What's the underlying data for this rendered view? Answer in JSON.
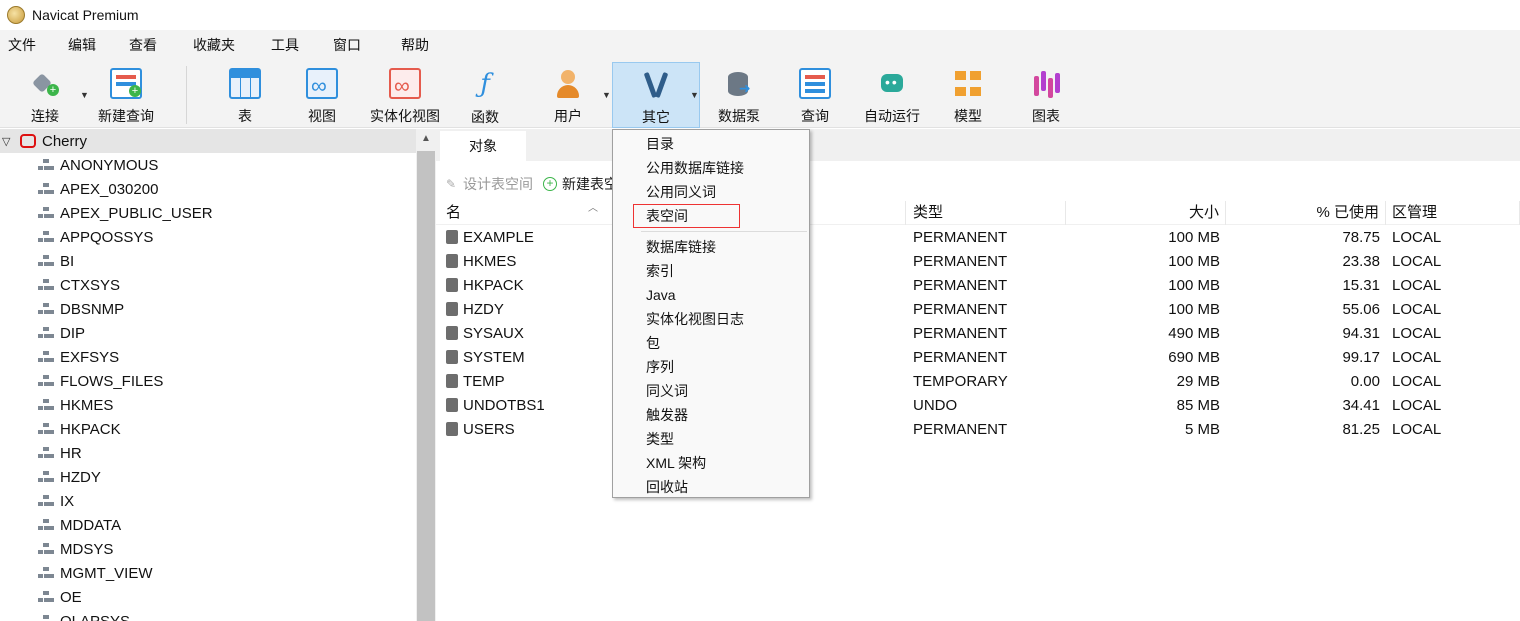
{
  "window": {
    "title": "Navicat Premium"
  },
  "menubar": [
    "文件",
    "编辑",
    "查看",
    "收藏夹",
    "工具",
    "窗口",
    "帮助"
  ],
  "toolbar": {
    "connect": "连接",
    "new_query": "新建查询",
    "table": "表",
    "view": "视图",
    "materialized_view": "实体化视图",
    "function": "函数",
    "user": "用户",
    "other": "其它",
    "data_pump": "数据泵",
    "query": "查询",
    "automation": "自动运行",
    "model": "模型",
    "chart": "图表"
  },
  "tree": {
    "connection": "Cherry",
    "schemas": [
      "ANONYMOUS",
      "APEX_030200",
      "APEX_PUBLIC_USER",
      "APPQOSSYS",
      "BI",
      "CTXSYS",
      "DBSNMP",
      "DIP",
      "EXFSYS",
      "FLOWS_FILES",
      "HKMES",
      "HKPACK",
      "HR",
      "HZDY",
      "IX",
      "MDDATA",
      "MDSYS",
      "MGMT_VIEW",
      "OE",
      "OLAPSYS"
    ]
  },
  "tabs": {
    "objects": "对象"
  },
  "object_toolbar": {
    "design": "设计表空间",
    "new": "新建表空间"
  },
  "grid": {
    "headers": {
      "name": "名",
      "type": "类型",
      "size": "大小",
      "pct_used": "% 已使用",
      "extent": "区管理"
    },
    "rows": [
      {
        "name": "EXAMPLE",
        "type": "PERMANENT",
        "size": "100 MB",
        "pct": "78.75",
        "extent": "LOCAL"
      },
      {
        "name": "HKMES",
        "type": "PERMANENT",
        "size": "100 MB",
        "pct": "23.38",
        "extent": "LOCAL"
      },
      {
        "name": "HKPACK",
        "type": "PERMANENT",
        "size": "100 MB",
        "pct": "15.31",
        "extent": "LOCAL"
      },
      {
        "name": "HZDY",
        "type": "PERMANENT",
        "size": "100 MB",
        "pct": "55.06",
        "extent": "LOCAL"
      },
      {
        "name": "SYSAUX",
        "type": "PERMANENT",
        "size": "490 MB",
        "pct": "94.31",
        "extent": "LOCAL"
      },
      {
        "name": "SYSTEM",
        "type": "PERMANENT",
        "size": "690 MB",
        "pct": "99.17",
        "extent": "LOCAL"
      },
      {
        "name": "TEMP",
        "type": "TEMPORARY",
        "size": "29 MB",
        "pct": "0.00",
        "extent": "LOCAL"
      },
      {
        "name": "UNDOTBS1",
        "type": "UNDO",
        "size": "85 MB",
        "pct": "34.41",
        "extent": "LOCAL"
      },
      {
        "name": "USERS",
        "type": "PERMANENT",
        "size": "5 MB",
        "pct": "81.25",
        "extent": "LOCAL"
      }
    ]
  },
  "dropdown": {
    "group1": [
      "目录",
      "公用数据库链接",
      "公用同义词",
      "表空间"
    ],
    "highlighted": "表空间",
    "group2": [
      "数据库链接",
      "索引",
      "Java",
      "实体化视图日志",
      "包",
      "序列",
      "同义词",
      "触发器",
      "类型",
      "XML 架构",
      "回收站"
    ]
  },
  "colors": {
    "accent": "#2f8fdd",
    "active_button": "#cce4f7",
    "highlight_box": "#ee3333"
  }
}
